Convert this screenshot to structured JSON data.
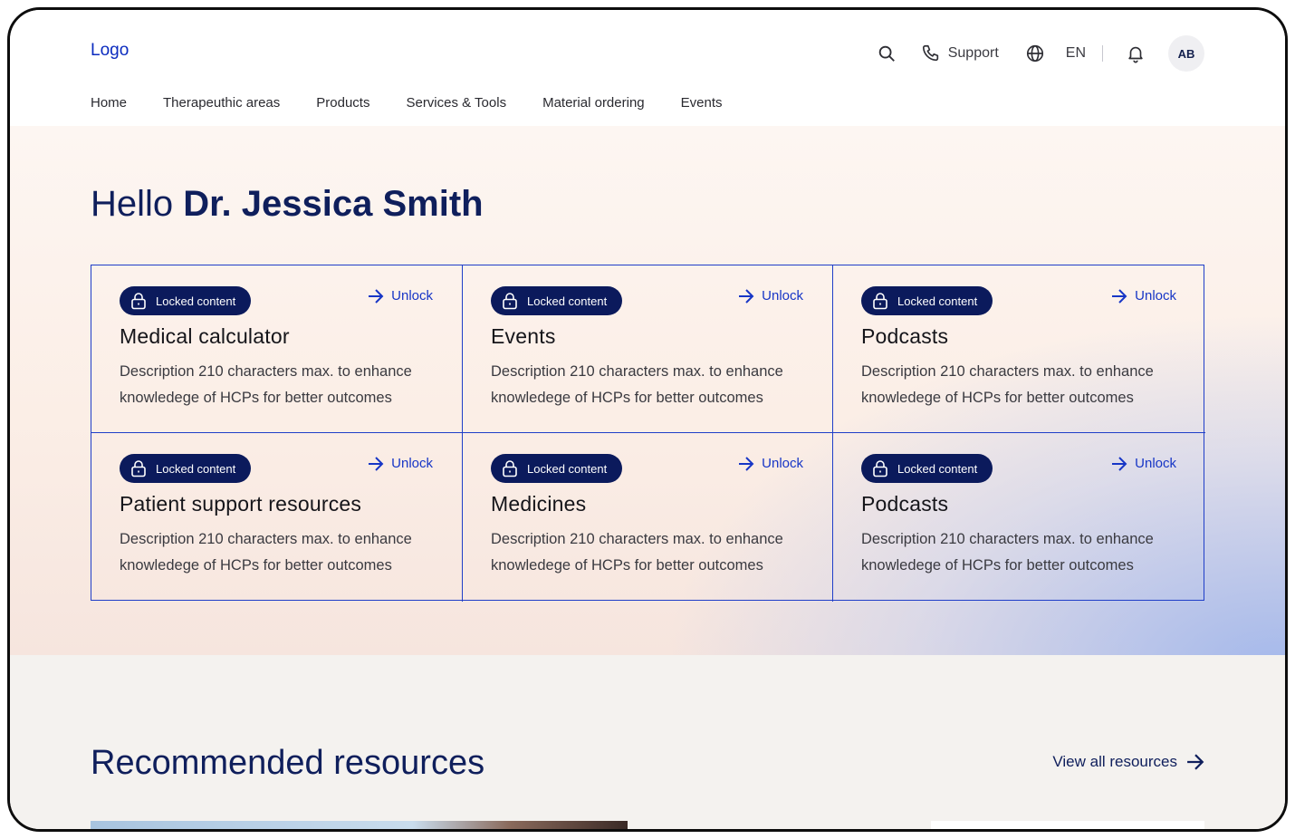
{
  "header": {
    "logo": "Logo",
    "support": "Support",
    "language": "EN",
    "avatar_initials": "AB"
  },
  "nav": [
    {
      "label": "Home"
    },
    {
      "label": "Therapeuthic areas"
    },
    {
      "label": "Products"
    },
    {
      "label": "Services & Tools"
    },
    {
      "label": "Material ordering"
    },
    {
      "label": "Events"
    }
  ],
  "hero": {
    "greeting_prefix": "Hello",
    "user_name": "Dr. Jessica Smith"
  },
  "cards": [
    {
      "badge": "Locked content",
      "action": "Unlock",
      "title": "Medical calculator",
      "description": "Description 210 characters max. to enhance knowledege of HCPs for better outcomes"
    },
    {
      "badge": "Locked content",
      "action": "Unlock",
      "title": "Events",
      "description": "Description 210 characters max. to enhance knowledege of HCPs for better outcomes"
    },
    {
      "badge": "Locked content",
      "action": "Unlock",
      "title": "Podcasts",
      "description": "Description 210 characters max. to enhance knowledege of HCPs for better outcomes"
    },
    {
      "badge": "Locked content",
      "action": "Unlock",
      "title": "Patient support resources",
      "description": "Description 210 characters max. to enhance knowledege of HCPs for better outcomes"
    },
    {
      "badge": "Locked content",
      "action": "Unlock",
      "title": "Medicines",
      "description": "Description 210 characters max. to enhance knowledege of HCPs for better outcomes"
    },
    {
      "badge": "Locked content",
      "action": "Unlock",
      "title": "Podcasts",
      "description": "Description 210 characters max. to enhance knowledege of HCPs for better outcomes"
    }
  ],
  "recommended": {
    "title": "Recommended resources",
    "view_all": "View all resources"
  },
  "colors": {
    "brand_blue": "#1736c6",
    "navy": "#0b1a5c",
    "heading_navy": "#0f1f5c"
  },
  "icons": [
    "search-icon",
    "phone-icon",
    "globe-icon",
    "bell-icon",
    "lock-icon",
    "arrow-right-icon"
  ]
}
